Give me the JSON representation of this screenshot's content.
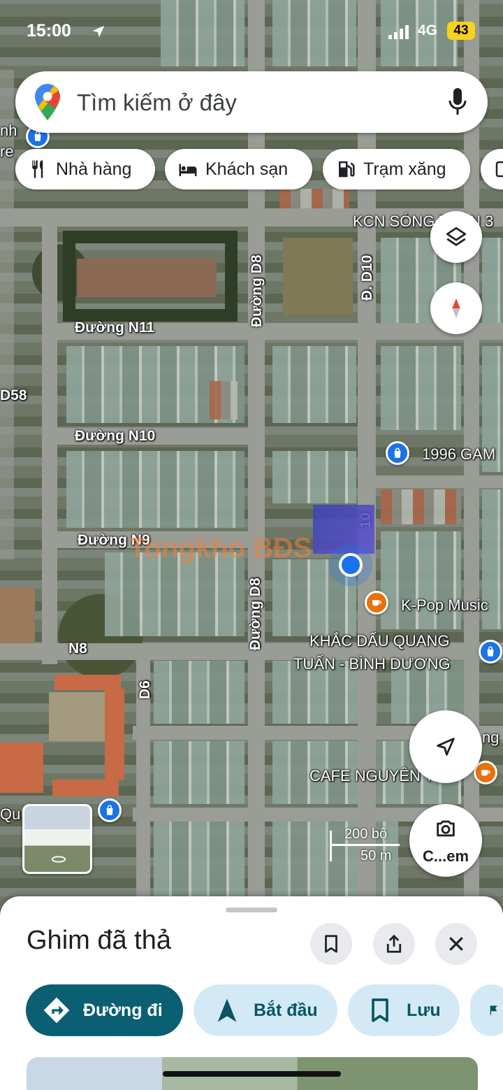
{
  "status_bar": {
    "time": "15:00",
    "network": "4G",
    "battery": "43"
  },
  "search": {
    "placeholder": "Tìm kiếm ở đây"
  },
  "chips": [
    {
      "label": "Nhà hàng",
      "icon": "restaurant-icon"
    },
    {
      "label": "Khách sạn",
      "icon": "hotel-icon"
    },
    {
      "label": "Trạm xăng",
      "icon": "gas-station-icon"
    }
  ],
  "map": {
    "roads": {
      "n11": "Đường N11",
      "n10": "Đường N10",
      "n9": "Đường N9",
      "n8": "N8",
      "d8_top": "Đường D8",
      "d8_bottom": "Đường D8",
      "d10": "Đ. D10",
      "d6": "D6",
      "d58": "D58",
      "d10_short": "10"
    },
    "places": {
      "kcn": "KCN SÓNG THẦN 3",
      "gam": "1996 GAM",
      "kpop": "K-Pop Music",
      "khacdau_1": "KHẮC DẤU QUANG",
      "khacdau_2": "TUẤN - BÌNH DƯƠNG",
      "cafe": "CAFE NGUYÊN TÔ",
      "left_partial": "nh re",
      "qu_partial": "Qu",
      "ng_partial": "ng"
    },
    "watermark": "Tongkho BĐS",
    "scale": {
      "imperial": "200 bộ",
      "metric": "50 m"
    },
    "lens_label": "C...em"
  },
  "sheet": {
    "title": "Ghim đã thả",
    "actions": {
      "directions": "Đường đi",
      "start": "Bắt đầu",
      "save": "Lưu"
    }
  },
  "colors": {
    "primary_action": "#0b5f73",
    "secondary_action": "#d3eaf6",
    "location_blue": "#1a73e8",
    "cafe_orange": "#e8710a"
  }
}
